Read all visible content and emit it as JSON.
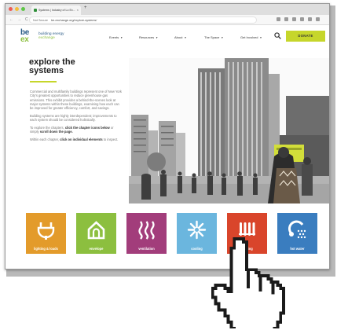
{
  "browser": {
    "tab_title": "Systems | Industry of Lo Ex...",
    "url_security": "Not Secure",
    "url_text": "be-exchange.org/explore-systems/"
  },
  "site": {
    "logo_top": "be",
    "logo_bottom": "ex",
    "logo_line1": "building energy",
    "logo_line2": "exchange",
    "nav": [
      "Events",
      "Resources",
      "About",
      "The Space",
      "Get Involved"
    ],
    "donate_label": "DONATE"
  },
  "hero": {
    "title_line1": "explore the",
    "title_line2": "systems",
    "paragraph1": "Commercial and multifamily buildings represent one of New York City's greatest opportunities to reduce greenhouse gas emissions. This exhibit provides a behind-the-scenes look at major systems within these buildings, examining how each can be improved for greater efficiency, comfort, and savings.",
    "paragraph2": "Building systems are highly interdependent; improvements to each system should be considered holistically.",
    "paragraph3_a": "To explore the chapters, ",
    "paragraph3_b": "click the chapter icons below",
    "paragraph3_c": " or simply ",
    "paragraph3_d": "scroll down the page.",
    "paragraph4_a": "Within each chapter, ",
    "paragraph4_b": "click on individual elements",
    "paragraph4_c": " to inspect."
  },
  "tiles": [
    {
      "label": "lighting & loads",
      "color": "#e39b2b",
      "icon": "plug-icon"
    },
    {
      "label": "envelope",
      "color": "#8cbf3f",
      "icon": "house-icon"
    },
    {
      "label": "ventilation",
      "color": "#a23d7b",
      "icon": "airflow-icon"
    },
    {
      "label": "cooling",
      "color": "#6bb6de",
      "icon": "snowflake-icon"
    },
    {
      "label": "heating",
      "color": "#d9452b",
      "icon": "radiator-icon"
    },
    {
      "label": "hot water",
      "color": "#3a7dbf",
      "icon": "shower-icon"
    }
  ],
  "colors": {
    "brand_blue": "#2b5c88",
    "brand_green": "#8cbf3f",
    "donate_bg": "#c6d62b"
  }
}
